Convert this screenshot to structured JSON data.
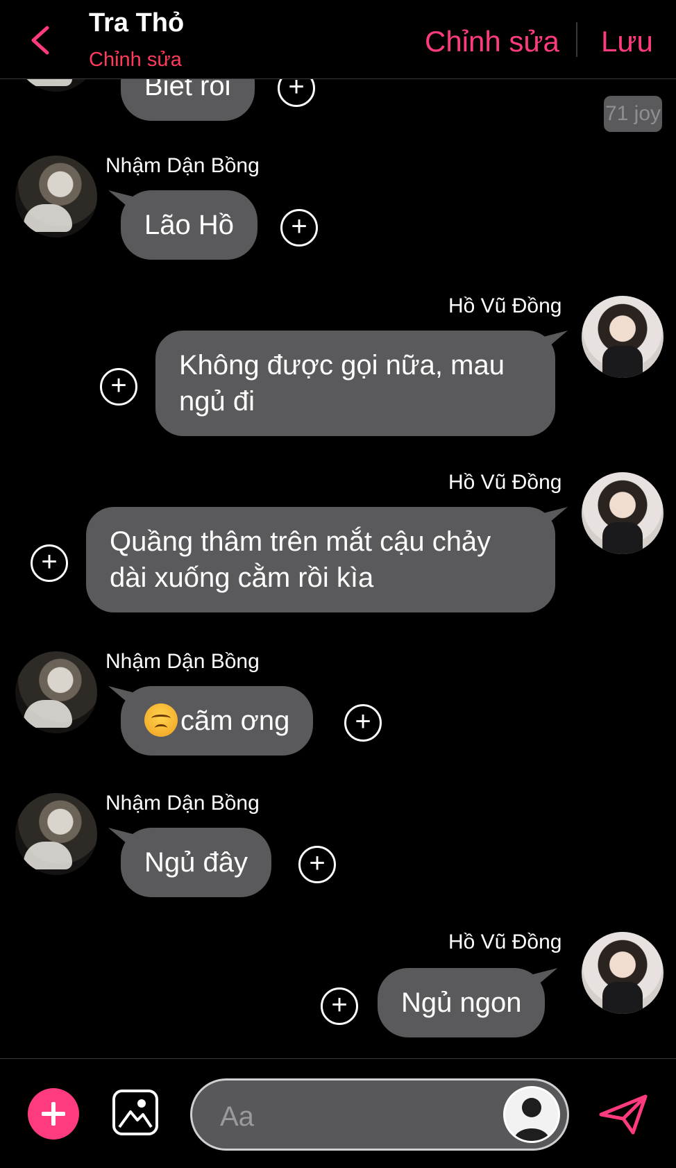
{
  "header": {
    "title": "Tra Thỏ",
    "subtitle": "Chỉnh sửa",
    "edit_label": "Chỉnh sửa",
    "save_label": "Lưu"
  },
  "colors": {
    "accent": "#ff3b7f",
    "bubble": "#5a5a5c",
    "background": "#000000"
  },
  "joy_badge": "71 joy",
  "messages": [
    {
      "sender": "",
      "text": "Biết rồi",
      "side": "left"
    },
    {
      "sender": "Nhậm Dận Bồng",
      "text": "Lão Hồ",
      "side": "left"
    },
    {
      "sender": "Hồ Vũ Đồng",
      "text": "Không được gọi nữa, mau ngủ đi",
      "side": "right"
    },
    {
      "sender": "Hồ Vũ Đồng",
      "text": "Quầng thâm trên mắt cậu chảy dài xuống cằm rồi kìa",
      "side": "right"
    },
    {
      "sender": "Nhậm Dận Bồng",
      "text": "cãm ơng",
      "emoji": "angry-face-emoji",
      "side": "left"
    },
    {
      "sender": "Nhậm Dận Bồng",
      "text": "Ngủ đây",
      "side": "left"
    },
    {
      "sender": "Hồ Vũ Đồng",
      "text": "Ngủ ngon",
      "side": "right"
    }
  ],
  "plus_symbol": "+",
  "composer": {
    "placeholder": "Aa"
  },
  "icons": [
    "back-chevron-icon",
    "plus-icon",
    "image-icon",
    "profile-icon",
    "send-icon"
  ]
}
